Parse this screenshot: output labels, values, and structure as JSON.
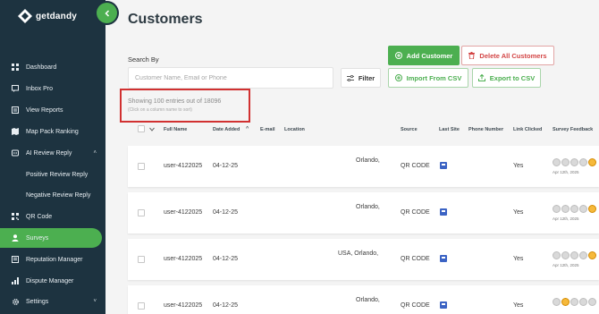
{
  "app": {
    "brand": "getdandy",
    "colors": {
      "sidebar": "#1d3340",
      "accent": "#4caf50",
      "danger": "#d34545",
      "highlight": "#d13131"
    }
  },
  "sidebar": {
    "items": [
      {
        "label": "Dashboard",
        "icon": "dashboard-icon"
      },
      {
        "label": "Inbox Pro",
        "icon": "chat-icon"
      },
      {
        "label": "View Reports",
        "icon": "report-icon"
      },
      {
        "label": "Map Pack Ranking",
        "icon": "map-icon"
      },
      {
        "label": "AI Review Reply",
        "icon": "ai-review-icon",
        "caret": "˄"
      },
      {
        "label": "Positive Review Reply"
      },
      {
        "label": "Negative Review Reply"
      },
      {
        "label": "QR Code",
        "icon": "qr-code-icon"
      },
      {
        "label": "Surveys",
        "icon": "surveys-icon",
        "active": true
      },
      {
        "label": "Reputation Manager",
        "icon": "reputation-icon"
      },
      {
        "label": "Dispute Manager",
        "icon": "dispute-icon"
      },
      {
        "label": "Settings",
        "icon": "gear-icon",
        "caret": "˅"
      }
    ]
  },
  "page": {
    "title": "Customers",
    "search": {
      "label": "Search By",
      "placeholder": "Customer Name, Email or Phone",
      "value": ""
    },
    "buttons": {
      "filter": "Filter",
      "add": "Add Customer",
      "delete_all": "Delete All Customers",
      "import": "Import From CSV",
      "export": "Export to CSV"
    },
    "entries": {
      "text": "Showing 100 entries out of 18096",
      "hint": "(Click on a column name to sort)"
    }
  },
  "table": {
    "columns": [
      "Full Name",
      "Date Added",
      "E-mail",
      "Location",
      "Source",
      "Last Site",
      "Phone Number",
      "Link Clicked",
      "Survey Feedback"
    ],
    "sort_indicator": "^",
    "rows": [
      {
        "name": "user-4122025",
        "date": "04-12-25",
        "location": "Orlando,",
        "source": "QR CODE",
        "link_clicked": "Yes",
        "feedback_date": "Apr 12th, 2025",
        "selected_face": 4
      },
      {
        "name": "user-4122025",
        "date": "04-12-25",
        "location": "Orlando,",
        "source": "QR CODE",
        "link_clicked": "Yes",
        "feedback_date": "Apr 12th, 2025",
        "selected_face": 4
      },
      {
        "name": "user-4122025",
        "date": "04-12-25",
        "location": "USA, Orlando,",
        "source": "QR CODE",
        "link_clicked": "Yes",
        "feedback_date": "Apr 12th, 2025",
        "selected_face": 4
      },
      {
        "name": "user-4122025",
        "date": "04-12-25",
        "location": "Orlando,",
        "source": "QR CODE",
        "link_clicked": "Yes",
        "feedback_date": "",
        "selected_face": 1
      }
    ]
  }
}
